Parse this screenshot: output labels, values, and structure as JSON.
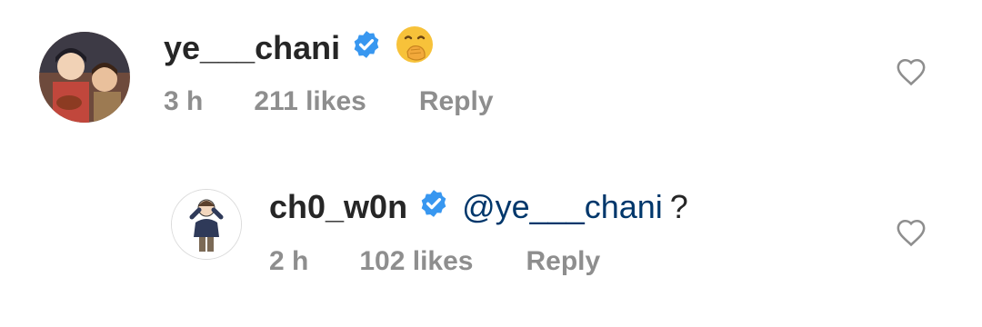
{
  "comments": [
    {
      "username": "ye___chani",
      "verified": true,
      "emoji_icon": "hand-over-mouth-emoji",
      "time": "3 h",
      "likes": "211 likes",
      "reply_label": "Reply"
    },
    {
      "username": "ch0_w0n",
      "verified": true,
      "mention": "@ye___chani",
      "text": "?",
      "time": "2 h",
      "likes": "102 likes",
      "reply_label": "Reply"
    }
  ],
  "colors": {
    "verified_badge": "#3897f0",
    "mention": "#00376b",
    "meta": "#8e8e8e",
    "heart_outline": "#8e8e8e"
  }
}
